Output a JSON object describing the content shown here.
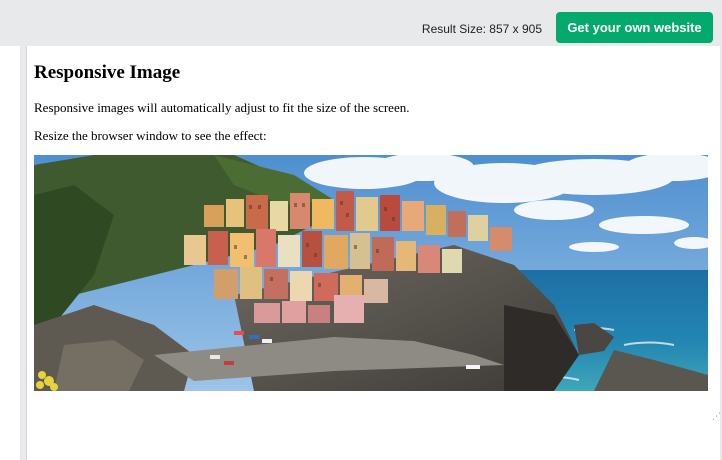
{
  "toolbar": {
    "result_size": "Result Size: 857 x 905",
    "cta_label": "Get your own website",
    "cta_color": "#04aa6d"
  },
  "page": {
    "heading": "Responsive Image",
    "paragraph_1": "Responsive images will automatically adjust to fit the size of the screen.",
    "paragraph_2": "Resize the browser window to see the effect:"
  },
  "image": {
    "subject": "Coastal cliffside village with colorful houses above the sea"
  }
}
